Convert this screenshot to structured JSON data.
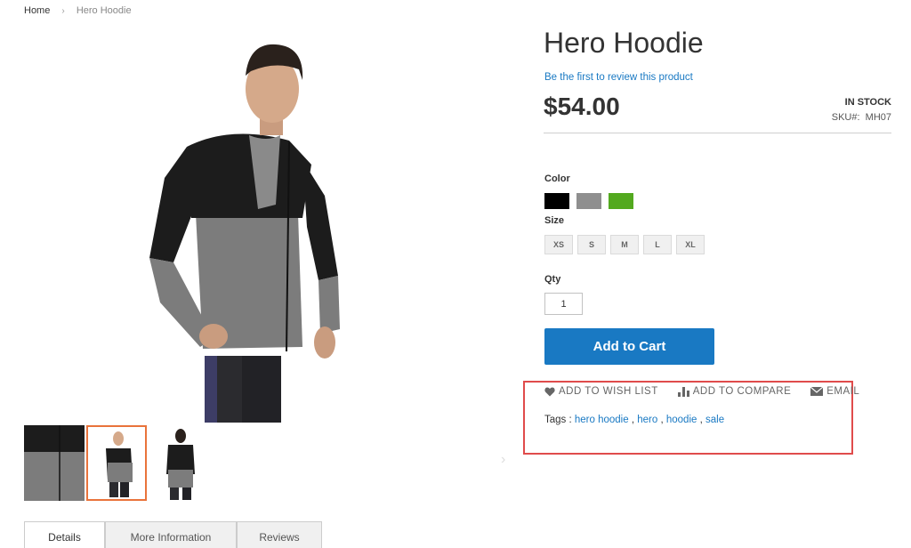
{
  "breadcrumb": {
    "home": "Home",
    "current": "Hero Hoodie"
  },
  "product": {
    "title": "Hero Hoodie",
    "review_link": "Be the first to review this product",
    "price": "$54.00",
    "stock": "IN STOCK",
    "sku_label": "SKU#:",
    "sku": "MH07"
  },
  "options": {
    "color_label": "Color",
    "colors": [
      "#000000",
      "#8f8f8f",
      "#53a91f"
    ],
    "size_label": "Size",
    "sizes": [
      "XS",
      "S",
      "M",
      "L",
      "XL"
    ],
    "qty_label": "Qty",
    "qty_value": "1"
  },
  "buttons": {
    "add_to_cart": "Add to Cart"
  },
  "actions": {
    "wishlist": "ADD TO WISH LIST",
    "compare": "ADD TO COMPARE",
    "email": "EMAIL"
  },
  "tags": {
    "label": "Tags :",
    "items": [
      "hero hoodie",
      "hero",
      "hoodie",
      "sale"
    ]
  },
  "tabs": [
    "Details",
    "More Information",
    "Reviews"
  ],
  "colors": {
    "accent": "#1979c3",
    "highlight": "#e04b4b",
    "thumb_active": "#e9733b"
  }
}
